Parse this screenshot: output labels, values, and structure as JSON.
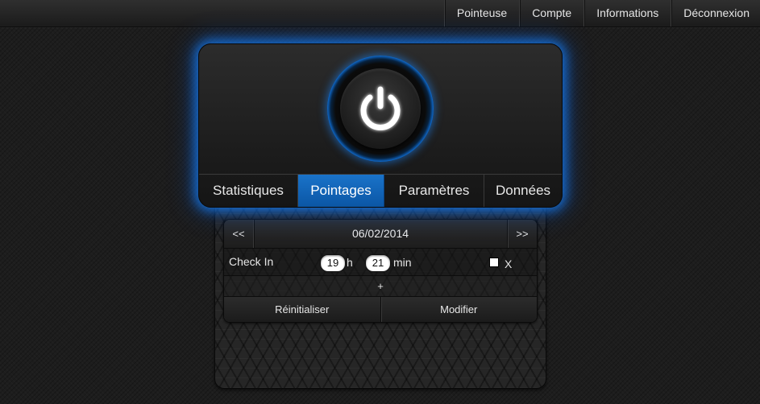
{
  "nav": {
    "items": [
      {
        "label": "Pointeuse"
      },
      {
        "label": "Compte"
      },
      {
        "label": "Informations"
      },
      {
        "label": "Déconnexion"
      }
    ]
  },
  "power": {
    "icon": "power-icon",
    "glow_color": "#1b86f0"
  },
  "tabs": [
    {
      "label": "Statistiques",
      "active": false
    },
    {
      "label": "Pointages",
      "active": true
    },
    {
      "label": "Paramètres",
      "active": false
    },
    {
      "label": "Données",
      "active": false
    }
  ],
  "pointage": {
    "prev_label": "<<",
    "next_label": ">>",
    "date": "06/02/2014",
    "entry": {
      "label": "Check In",
      "hour": "19",
      "hour_unit": "h",
      "minute": "21",
      "minute_unit": "min",
      "delete_checked": false,
      "delete_label": "X"
    },
    "add_label": "+",
    "reset_label": "Réinitialiser",
    "modify_label": "Modifier"
  },
  "colors": {
    "accent": "#0f63b8",
    "background": "#1d1d1d"
  }
}
